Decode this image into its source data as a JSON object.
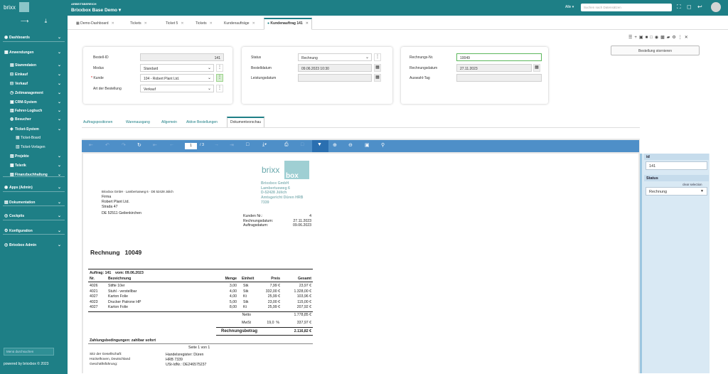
{
  "sidebar": {
    "logo_text": "brixx",
    "logo_sub": "box",
    "items": [
      {
        "label": "Dashboards",
        "icon": "dashboard-icon"
      },
      {
        "label": "Anwendungen",
        "icon": "apps-icon"
      },
      {
        "label": "Stammdaten",
        "icon": "database-icon"
      },
      {
        "label": "Einkauf",
        "icon": "cart-icon"
      },
      {
        "label": "Verkauf",
        "icon": "cart-icon"
      },
      {
        "label": "Zeitmanagement",
        "icon": "clock-icon"
      },
      {
        "label": "CRM-System",
        "icon": "crm-icon"
      },
      {
        "label": "Fahrer-Logbuch",
        "icon": "car-icon"
      },
      {
        "label": "Besucher",
        "icon": "visitor-icon"
      },
      {
        "label": "Ticket-System",
        "icon": "ticket-icon"
      },
      {
        "label": "Ticket-Board",
        "icon": "board-icon"
      },
      {
        "label": "Ticket-Vorlagen",
        "icon": "template-icon"
      },
      {
        "label": "Projekte",
        "icon": "project-icon"
      },
      {
        "label": "Telerik",
        "icon": "telerik-icon"
      },
      {
        "label": "Finanzbuchhaltung",
        "icon": "finance-icon"
      },
      {
        "label": "Apps (Admin)",
        "icon": "admin-apps-icon"
      },
      {
        "label": "Dokumentation",
        "icon": "docs-icon"
      },
      {
        "label": "Cockpits",
        "icon": "cockpit-icon"
      },
      {
        "label": "Konfiguration",
        "icon": "config-icon"
      },
      {
        "label": "Brixxbox Admin",
        "icon": "admin-icon"
      }
    ],
    "search_placeholder": "Menü durchsuchen",
    "footer": "powered by brixxbox © 2023"
  },
  "topbar": {
    "workspace_label": "ARBEITSBEREICH",
    "workspace_name": "Brixxbox Base Demo",
    "scope": "Alle",
    "search_placeholder": "Suchen nach Datensätzen"
  },
  "tabs": [
    {
      "label": "Demo-Dashboard"
    },
    {
      "label": "Tickets"
    },
    {
      "label": "Ticket 5"
    },
    {
      "label": "Tickets"
    },
    {
      "label": "Kundenaufträge"
    },
    {
      "label": "Kundenauftrag 141"
    }
  ],
  "storno_button": "Bestellung stornieren",
  "form": {
    "bestell_id": {
      "label": "Bestell-ID",
      "value": "141"
    },
    "modus": {
      "label": "Modus",
      "value": "Standard"
    },
    "kunde": {
      "label": "Kunde",
      "required": "*",
      "value": "104 - Robert Plant Ltd."
    },
    "art": {
      "label": "Art der Bestellung",
      "value": "Verkauf"
    },
    "status": {
      "label": "Status",
      "value": "Rechnung"
    },
    "bestelldatum": {
      "label": "Bestelldatum",
      "value": "09.06.2023 10:30"
    },
    "leistungsdatum": {
      "label": "Leistungsdatum",
      "value": ""
    },
    "rechnungs_nr": {
      "label": "Rechnungs-Nr.",
      "value": "10049"
    },
    "rechnungsdatum": {
      "label": "Rechnungsdatum",
      "value": "27.11.2023"
    },
    "auswahl_tag": {
      "label": "Auswahl-Tag",
      "value": ""
    }
  },
  "subtabs": [
    {
      "label": "Auftragspositionen"
    },
    {
      "label": "Warenausgang"
    },
    {
      "label": "Allgemein"
    },
    {
      "label": "Aktive Bestellungen"
    },
    {
      "label": "Dokumentvorschau"
    }
  ],
  "viewer": {
    "page_current": "1",
    "page_total": "/ 3"
  },
  "doc": {
    "logo_text": "brixx",
    "logo_sub": "box",
    "company_lines": [
      "Brixxbox GmbH",
      "Lambertusweg 6",
      "D-52428 Jülich",
      "Amtsgericht Düren HRB",
      "7339"
    ],
    "sender_line": "Brixxbox GmbH · Lambertusweg 6 · DE 52428 Jülich",
    "recipient": [
      "Firma",
      "Robert Plant Ltd.",
      "Strada  47",
      "",
      "DE 52511 Geilenkirchen"
    ],
    "meta": [
      {
        "k": "Kunden Nr.:",
        "v": "4"
      },
      {
        "k": "Rechnungsdatum:",
        "v": "27.11.2023"
      },
      {
        "k": "Auftragsdatum:",
        "v": "09.06.2023"
      }
    ],
    "title": "Rechnung   10049",
    "order_line": "Auftrag: 141    vom: 09.06.2023",
    "headers": [
      "Nr.",
      "Bezeichnung",
      "Menge",
      "Einheit",
      "Preis",
      "Gesamt"
    ],
    "rows": [
      [
        "4026",
        "Stifte 10er",
        "3,00",
        "Stk",
        "7,99 €",
        "23,97 €"
      ],
      [
        "4021",
        "Stuhl - verstellbar",
        "4,00",
        "Stk",
        "332,00 €",
        "1.328,00 €"
      ],
      [
        "4027",
        "Karton Folie",
        "4,00",
        "Kt",
        "25,99 €",
        "103,96 €"
      ],
      [
        "4023",
        "Drucker Patrone HP",
        "5,00",
        "Stk",
        "23,00 €",
        "115,00 €"
      ],
      [
        "4027",
        "Karton Folie",
        "8,00",
        "Kt",
        "25,99 €",
        "207,92 €"
      ]
    ],
    "netto_label": "Netto",
    "netto_value": "1.778,85 €",
    "mwst_label": "MwSt",
    "mwst_rate": "19,0  %",
    "mwst_value": "337,97 €",
    "total_label": "Rechnungsbetrag",
    "total_value": "2.116,82 €",
    "payment_terms": "Zahlungsbedingungen: zahlbar sofort",
    "page_footer": "Seite 1 von 1",
    "footer_left": [
      "Sitz der Gesellschaft:",
      "Hückelhoven, Deutschland",
      "Geschäftsführung:"
    ],
    "footer_right": [
      "Handelsregister: Düren",
      "HRB 7339",
      "USt-IdNr.: DE246575237"
    ]
  },
  "right_panel": {
    "id_label": "id",
    "id_value": "141",
    "status_label": "Status",
    "clear_selection": "clear selection",
    "status_value": "Rechnung"
  }
}
